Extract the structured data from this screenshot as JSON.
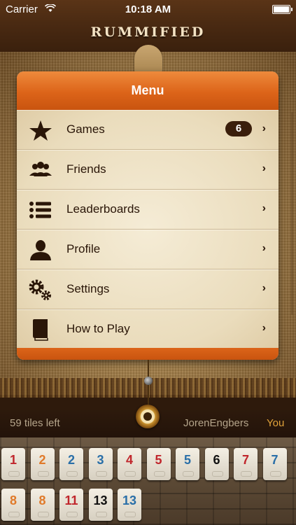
{
  "status_bar": {
    "carrier": "Carrier",
    "time": "10:18 AM"
  },
  "app": {
    "title": "RUMMIFIED"
  },
  "menu": {
    "title": "Menu",
    "items": [
      {
        "label": "Games",
        "icon": "star-icon",
        "badge": "6"
      },
      {
        "label": "Friends",
        "icon": "group-icon"
      },
      {
        "label": "Leaderboards",
        "icon": "list-icon"
      },
      {
        "label": "Profile",
        "icon": "person-icon"
      },
      {
        "label": "Settings",
        "icon": "gears-icon"
      },
      {
        "label": "How to Play",
        "icon": "book-icon"
      }
    ],
    "chevron": "›"
  },
  "game_info": {
    "tiles_left": "59 tiles left",
    "opponent": "JorenEngbers",
    "you": "You"
  },
  "rack": {
    "row1": [
      {
        "n": "1",
        "color": "#c0262c"
      },
      {
        "n": "2",
        "color": "#e07a2a"
      },
      {
        "n": "2",
        "color": "#2a6fa8"
      },
      {
        "n": "3",
        "color": "#2a6fa8"
      },
      {
        "n": "4",
        "color": "#c0262c"
      },
      {
        "n": "5",
        "color": "#c0262c"
      },
      {
        "n": "5",
        "color": "#2a6fa8"
      },
      {
        "n": "6",
        "color": "#111111"
      },
      {
        "n": "7",
        "color": "#c0262c"
      },
      {
        "n": "7",
        "color": "#2a6fa8"
      }
    ],
    "row2": [
      {
        "n": "8",
        "color": "#e07a2a"
      },
      {
        "n": "8",
        "color": "#e07a2a"
      },
      {
        "n": "11",
        "color": "#c0262c"
      },
      {
        "n": "13",
        "color": "#111111"
      },
      {
        "n": "13",
        "color": "#2a6fa8"
      }
    ]
  }
}
